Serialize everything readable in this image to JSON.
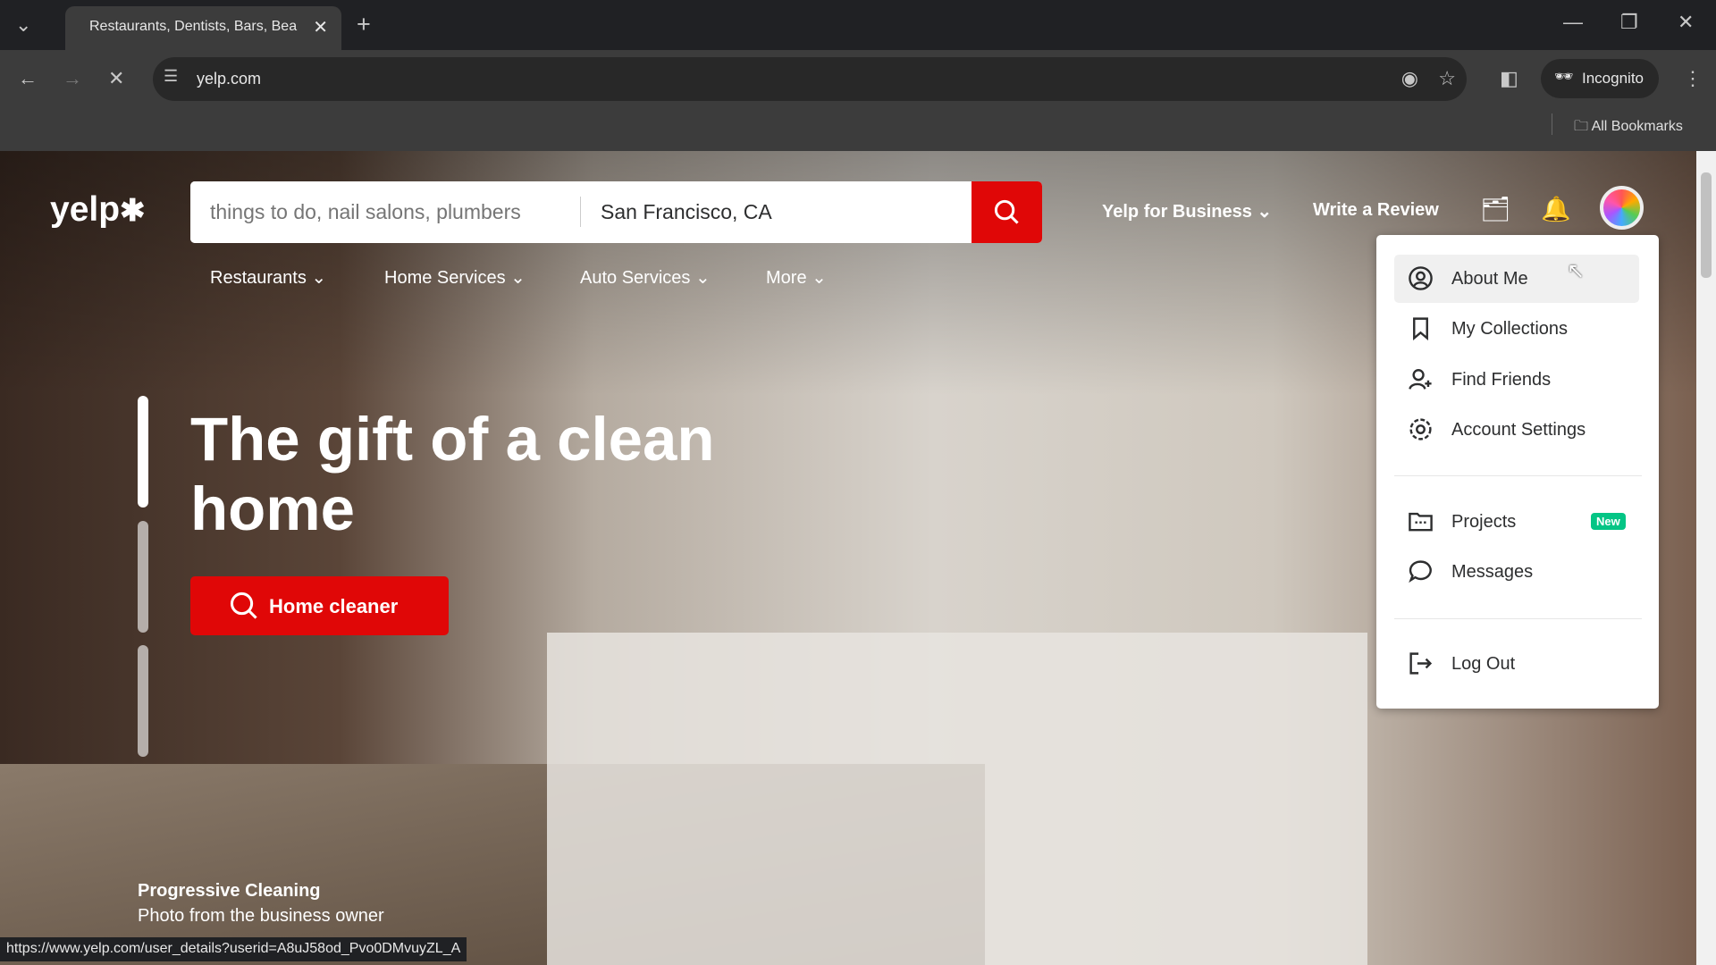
{
  "browser": {
    "tab_title": "Restaurants, Dentists, Bars, Bea",
    "url": "yelp.com",
    "incognito_label": "Incognito",
    "bookmarks_label": "All Bookmarks",
    "status_url": "https://www.yelp.com/user_details?userid=A8uJ58od_Pvo0DMvuyZL_A"
  },
  "header": {
    "logo": "yelp",
    "search_placeholder": "things to do, nail salons, plumbers",
    "location_value": "San Francisco, CA",
    "business_label": "Yelp for Business",
    "review_label": "Write a Review"
  },
  "nav": [
    {
      "label": "Restaurants"
    },
    {
      "label": "Home Services"
    },
    {
      "label": "Auto Services"
    },
    {
      "label": "More"
    }
  ],
  "hero": {
    "title": "The gift of a clean home",
    "cta": "Home cleaner",
    "business": "Progressive Cleaning",
    "caption": "Photo from the business owner"
  },
  "menu": {
    "items": [
      {
        "label": "About Me",
        "icon": "user-circle-icon"
      },
      {
        "label": "My Collections",
        "icon": "bookmark-icon"
      },
      {
        "label": "Find Friends",
        "icon": "add-friend-icon"
      },
      {
        "label": "Account Settings",
        "icon": "gear-icon"
      },
      {
        "label": "Projects",
        "icon": "projects-icon",
        "badge": "New"
      },
      {
        "label": "Messages",
        "icon": "chat-icon"
      },
      {
        "label": "Log Out",
        "icon": "logout-icon"
      }
    ]
  },
  "colors": {
    "brand_red": "#e00707",
    "badge_green": "#04c585"
  }
}
